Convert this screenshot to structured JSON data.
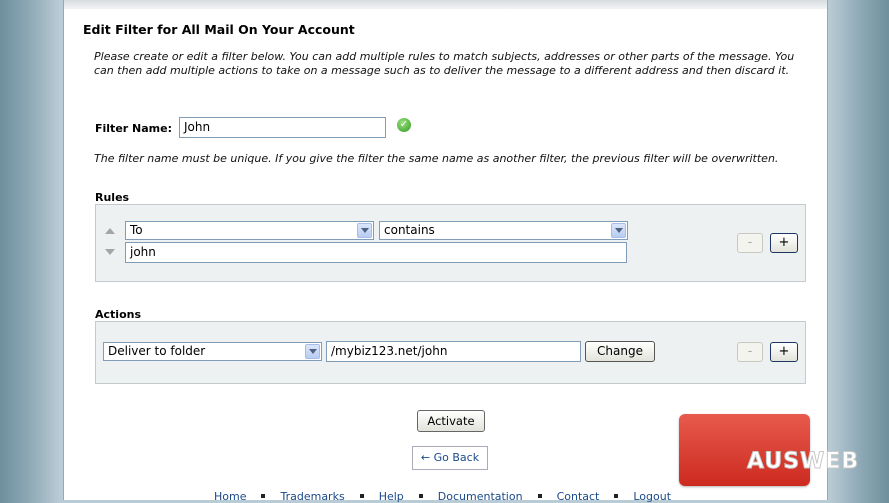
{
  "page": {
    "title": "Edit Filter for All Mail On Your Account",
    "description": "Please create or edit a filter below. You can add multiple rules to match subjects, addresses or other parts of the message. You can then add multiple actions to take on a message such as to deliver the message to a different address and then discard it."
  },
  "filter": {
    "name_label": "Filter Name:",
    "name_value": "John",
    "unique_note": "The filter name must be unique. If you give the filter the same name as another filter, the previous filter will be overwritten."
  },
  "rules": {
    "label": "Rules",
    "field": "To",
    "operator": "contains",
    "value": "john",
    "minus_label": "-",
    "plus_label": "+"
  },
  "actions": {
    "label": "Actions",
    "action": "Deliver to folder",
    "destination": "/mybiz123.net/john",
    "change_label": "Change",
    "minus_label": "-",
    "plus_label": "+"
  },
  "buttons": {
    "activate": "Activate",
    "go_back": "← Go Back"
  },
  "footer": {
    "links": [
      "Home",
      "Trademarks",
      "Help",
      "Documentation",
      "Contact",
      "Logout"
    ]
  },
  "logo": {
    "text": "AUSWEB"
  },
  "icons": {
    "name_valid": "check-icon",
    "rule_up": "arrow-up-icon",
    "rule_down": "arrow-down-icon"
  }
}
